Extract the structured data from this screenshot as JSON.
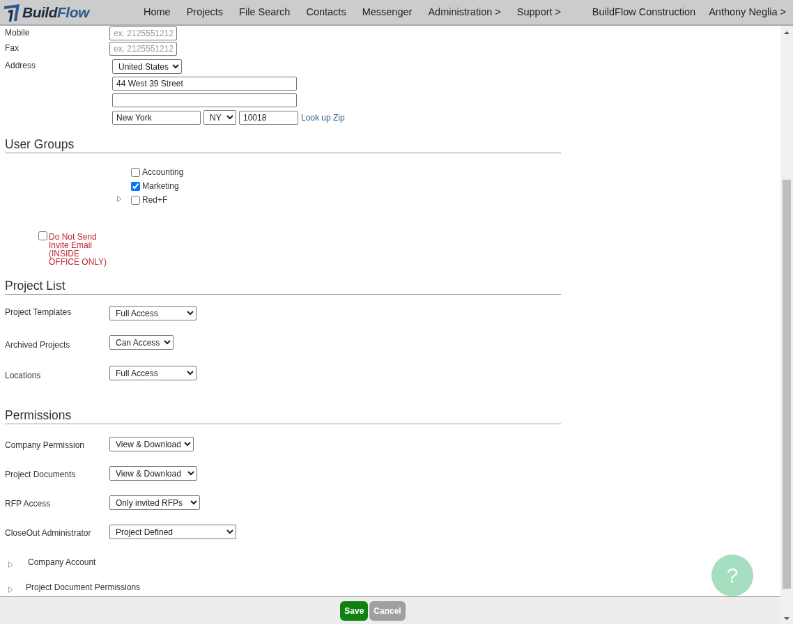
{
  "header": {
    "logo": {
      "text_1": "Build",
      "text_2": "Flow"
    },
    "menu": [
      "Home",
      "Projects",
      "File Search",
      "Contacts",
      "Messenger",
      "Administration >",
      "Support >"
    ],
    "company": "BuildFlow Construction",
    "user": "Anthony Neglia >"
  },
  "contact_fields": [
    {
      "label": "Mobile",
      "placeholder": "ex. 2125551212"
    },
    {
      "label": "Fax",
      "placeholder": "ex. 2125551212"
    }
  ],
  "address": {
    "label": "Address",
    "country": "United States",
    "street_1": "44 West 39 Street",
    "city": "New York",
    "state": "NY",
    "zip": "10018",
    "lookup_link": "Look up Zip"
  },
  "user_groups": {
    "title": "User Groups",
    "groups": [
      {
        "name": "Accounting",
        "checked": false
      },
      {
        "name": "Marketing",
        "checked": true
      },
      {
        "name": "Red+F",
        "checked": false
      }
    ]
  },
  "invite_option": {
    "label": "Do Not Send Invite Email (INSIDE OFFICE ONLY)",
    "checked": false
  },
  "project_list": {
    "title": "Project List",
    "settings": [
      {
        "label": "Project Templates",
        "value": "Full Access"
      },
      {
        "label": "Archived Projects",
        "value": "Can Access"
      },
      {
        "label": "Locations",
        "value": "Full Access"
      }
    ]
  },
  "permissions": {
    "title": "Permissions",
    "settings": [
      {
        "label": "Company Permission",
        "value": "View & Download"
      },
      {
        "label": "Project Documents",
        "value": "View & Download"
      },
      {
        "label": "RFP Access",
        "value": "Only invited RFPs"
      },
      {
        "label": "CloseOut Administrator",
        "value": "Project Defined"
      }
    ],
    "sections": [
      {
        "label": "Company Account",
        "expanded": false
      },
      {
        "label": "Project Document Permissions",
        "expanded": false
      }
    ]
  },
  "help_button": {
    "label": "?"
  },
  "footer": {
    "buttons": [
      {
        "label": "Save",
        "kind": "primary"
      },
      {
        "label": "Cancel",
        "kind": "secondary"
      }
    ]
  }
}
